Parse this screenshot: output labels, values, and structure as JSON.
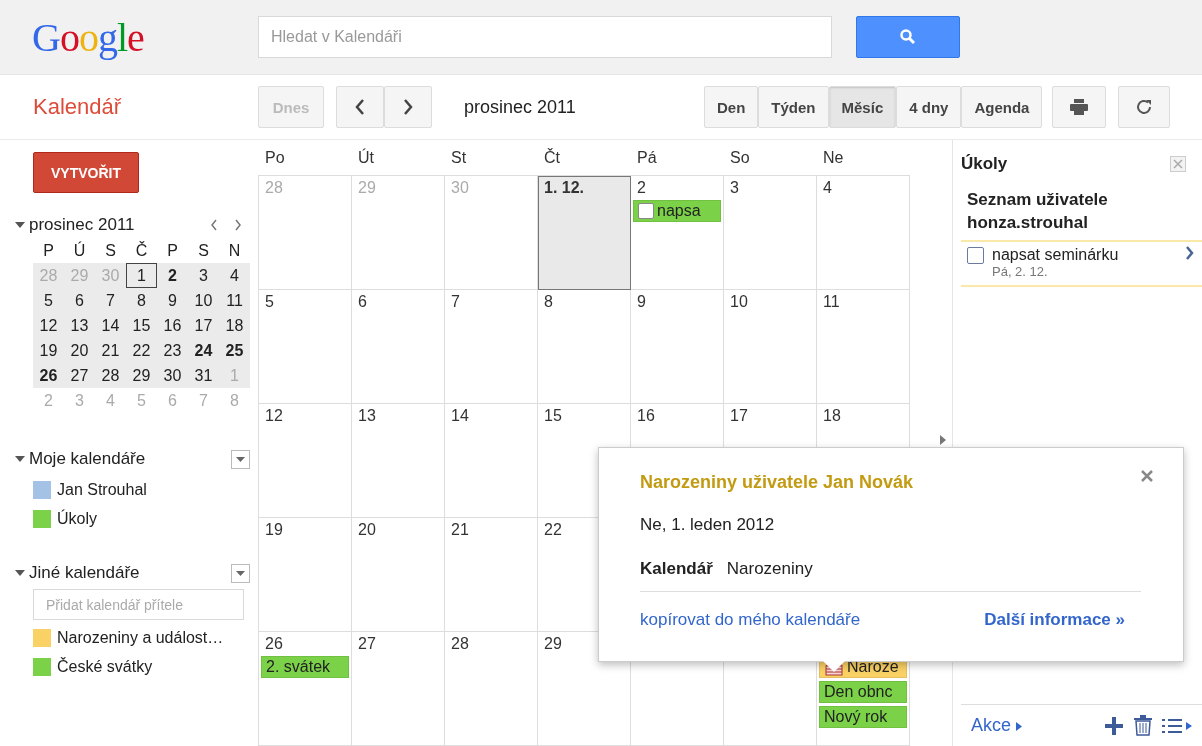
{
  "header": {
    "logo": "Google",
    "search": {
      "placeholder": "Hledat v Kalendáři"
    },
    "app_name": "Kalendář"
  },
  "toolbar": {
    "today": {
      "label": "Dnes",
      "disabled": true
    },
    "period": "prosinec 2011",
    "views": [
      {
        "label": "Den",
        "selected": false
      },
      {
        "label": "Týden",
        "selected": false
      },
      {
        "label": "Měsíc",
        "selected": true
      },
      {
        "label": "4 dny",
        "selected": false
      },
      {
        "label": "Agenda",
        "selected": false
      }
    ]
  },
  "sidebar": {
    "create": "VYTVOŘIT",
    "mini_calendar": {
      "title": "prosinec 2011",
      "weekdays": [
        "P",
        "Ú",
        "S",
        "Č",
        "P",
        "S",
        "N"
      ],
      "weeks": [
        {
          "in_view": true,
          "days": [
            {
              "d": "28",
              "muted": true,
              "bold": false,
              "today": false
            },
            {
              "d": "29",
              "muted": true,
              "bold": false,
              "today": false
            },
            {
              "d": "30",
              "muted": true,
              "bold": false,
              "today": false
            },
            {
              "d": "1",
              "muted": false,
              "bold": false,
              "today": true
            },
            {
              "d": "2",
              "muted": false,
              "bold": true,
              "today": false
            },
            {
              "d": "3",
              "muted": false,
              "bold": false,
              "today": false
            },
            {
              "d": "4",
              "muted": false,
              "bold": false,
              "today": false
            }
          ]
        },
        {
          "in_view": true,
          "days": [
            {
              "d": "5",
              "muted": false,
              "bold": false,
              "today": false
            },
            {
              "d": "6",
              "muted": false,
              "bold": false,
              "today": false
            },
            {
              "d": "7",
              "muted": false,
              "bold": false,
              "today": false
            },
            {
              "d": "8",
              "muted": false,
              "bold": false,
              "today": false
            },
            {
              "d": "9",
              "muted": false,
              "bold": false,
              "today": false
            },
            {
              "d": "10",
              "muted": false,
              "bold": false,
              "today": false
            },
            {
              "d": "11",
              "muted": false,
              "bold": false,
              "today": false
            }
          ]
        },
        {
          "in_view": true,
          "days": [
            {
              "d": "12",
              "muted": false,
              "bold": false,
              "today": false
            },
            {
              "d": "13",
              "muted": false,
              "bold": false,
              "today": false
            },
            {
              "d": "14",
              "muted": false,
              "bold": false,
              "today": false
            },
            {
              "d": "15",
              "muted": false,
              "bold": false,
              "today": false
            },
            {
              "d": "16",
              "muted": false,
              "bold": false,
              "today": false
            },
            {
              "d": "17",
              "muted": false,
              "bold": false,
              "today": false
            },
            {
              "d": "18",
              "muted": false,
              "bold": false,
              "today": false
            }
          ]
        },
        {
          "in_view": true,
          "days": [
            {
              "d": "19",
              "muted": false,
              "bold": false,
              "today": false
            },
            {
              "d": "20",
              "muted": false,
              "bold": false,
              "today": false
            },
            {
              "d": "21",
              "muted": false,
              "bold": false,
              "today": false
            },
            {
              "d": "22",
              "muted": false,
              "bold": false,
              "today": false
            },
            {
              "d": "23",
              "muted": false,
              "bold": false,
              "today": false
            },
            {
              "d": "24",
              "muted": false,
              "bold": true,
              "today": false
            },
            {
              "d": "25",
              "muted": false,
              "bold": true,
              "today": false
            }
          ]
        },
        {
          "in_view": true,
          "days": [
            {
              "d": "26",
              "muted": false,
              "bold": true,
              "today": false
            },
            {
              "d": "27",
              "muted": false,
              "bold": false,
              "today": false
            },
            {
              "d": "28",
              "muted": false,
              "bold": false,
              "today": false
            },
            {
              "d": "29",
              "muted": false,
              "bold": false,
              "today": false
            },
            {
              "d": "30",
              "muted": false,
              "bold": false,
              "today": false
            },
            {
              "d": "31",
              "muted": false,
              "bold": false,
              "today": false
            },
            {
              "d": "1",
              "muted": true,
              "bold": false,
              "today": false
            }
          ]
        },
        {
          "in_view": false,
          "days": [
            {
              "d": "2",
              "muted": true,
              "bold": false,
              "today": false
            },
            {
              "d": "3",
              "muted": true,
              "bold": false,
              "today": false
            },
            {
              "d": "4",
              "muted": true,
              "bold": false,
              "today": false
            },
            {
              "d": "5",
              "muted": true,
              "bold": false,
              "today": false
            },
            {
              "d": "6",
              "muted": true,
              "bold": false,
              "today": false
            },
            {
              "d": "7",
              "muted": true,
              "bold": false,
              "today": false
            },
            {
              "d": "8",
              "muted": true,
              "bold": false,
              "today": false
            }
          ]
        }
      ]
    },
    "sections": [
      {
        "title": "Moje kalendáře",
        "items": [
          {
            "name": "Jan Strouhal",
            "color": "#a4c2e6"
          },
          {
            "name": "Úkoly",
            "color": "#7bd148"
          }
        ]
      },
      {
        "title": "Jiné kalendáře",
        "add_placeholder": "Přidat kalendář přítele",
        "items": [
          {
            "name": "Narozeniny a událost…",
            "color": "#fad165"
          },
          {
            "name": "České svátky",
            "color": "#7bd148"
          }
        ]
      }
    ]
  },
  "calendar": {
    "weekdays": [
      "Po",
      "Út",
      "St",
      "Čt",
      "Pá",
      "So",
      "Ne"
    ],
    "weeks": [
      {
        "cells": [
          {
            "day": "28",
            "muted": true,
            "today": false
          },
          {
            "day": "29",
            "muted": true,
            "today": false
          },
          {
            "day": "30",
            "muted": true,
            "today": false
          },
          {
            "day": "1. 12.",
            "muted": false,
            "today": true
          },
          {
            "day": "2",
            "muted": false,
            "today": false,
            "events": [
              {
                "kind": "task",
                "text": "napsa",
                "color": "#7bd148"
              }
            ]
          },
          {
            "day": "3",
            "muted": false,
            "today": false
          },
          {
            "day": "4",
            "muted": false,
            "today": false
          }
        ]
      },
      {
        "cells": [
          {
            "day": "5",
            "muted": false,
            "today": false
          },
          {
            "day": "6",
            "muted": false,
            "today": false
          },
          {
            "day": "7",
            "muted": false,
            "today": false
          },
          {
            "day": "8",
            "muted": false,
            "today": false
          },
          {
            "day": "9",
            "muted": false,
            "today": false
          },
          {
            "day": "10",
            "muted": false,
            "today": false
          },
          {
            "day": "11",
            "muted": false,
            "today": false
          }
        ]
      },
      {
        "cells": [
          {
            "day": "12",
            "muted": false,
            "today": false
          },
          {
            "day": "13",
            "muted": false,
            "today": false
          },
          {
            "day": "14",
            "muted": false,
            "today": false
          },
          {
            "day": "15",
            "muted": false,
            "today": false
          },
          {
            "day": "16",
            "muted": false,
            "today": false
          },
          {
            "day": "17",
            "muted": false,
            "today": false
          },
          {
            "day": "18",
            "muted": false,
            "today": false
          }
        ]
      },
      {
        "cells": [
          {
            "day": "19",
            "muted": false,
            "today": false
          },
          {
            "day": "20",
            "muted": false,
            "today": false
          },
          {
            "day": "21",
            "muted": false,
            "today": false
          },
          {
            "day": "22",
            "muted": false,
            "today": false
          },
          {},
          {},
          {}
        ]
      },
      {
        "cells": [
          {
            "day": "26",
            "muted": false,
            "today": false,
            "events": [
              {
                "kind": "event",
                "text": "2. svátek",
                "color": "#7bd148"
              }
            ]
          },
          {
            "day": "27",
            "muted": false,
            "today": false
          },
          {
            "day": "28",
            "muted": false,
            "today": false
          },
          {
            "day": "29",
            "muted": false,
            "today": false
          },
          {
            "today": false
          },
          {
            "today": false
          },
          {
            "today": false,
            "events": [
              {
                "kind": "birthday",
                "text": "Naroze",
                "color": "#fad165"
              },
              {
                "kind": "event",
                "text": "Den obnc",
                "color": "#7bd148"
              },
              {
                "kind": "event",
                "text": "Nový rok",
                "color": "#7bd148"
              }
            ]
          }
        ]
      }
    ]
  },
  "tasks": {
    "title": "Úkoly",
    "list_title": "Seznam uživatele honza.strouhal",
    "items": [
      {
        "text": "napsat seminárku",
        "due": "Pá, 2. 12.",
        "checked": false
      }
    ],
    "actions": "Akce"
  },
  "popup": {
    "title": "Narozeniny uživatele Jan Novák",
    "date": "Ne, 1. leden 2012",
    "calendar_label": "Kalendář",
    "calendar_value": "Narozeniny",
    "copy_link": "kopírovat do mého kalendáře",
    "more_link": "Další informace »"
  }
}
